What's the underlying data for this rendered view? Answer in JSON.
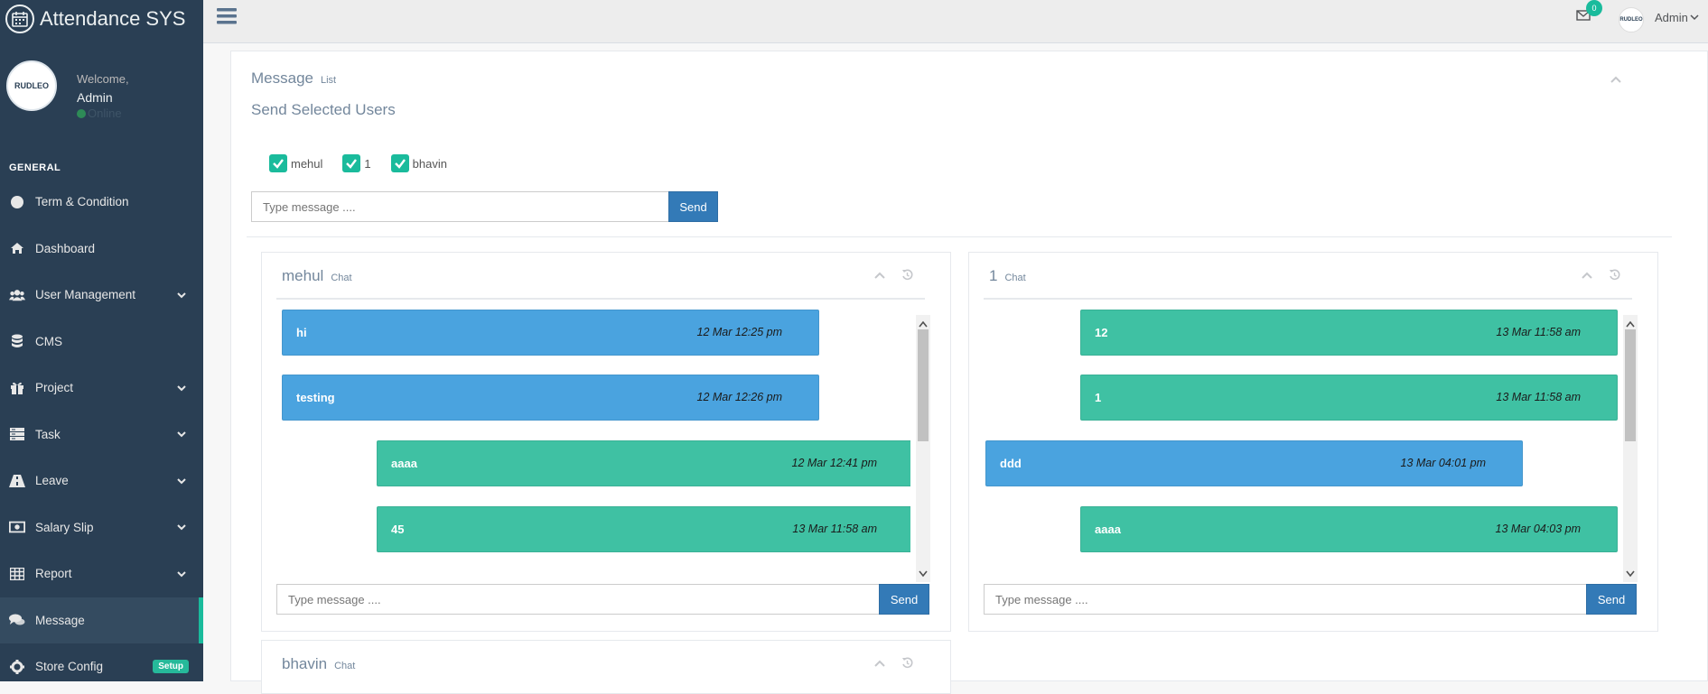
{
  "brand": {
    "title": "Attendance SYS",
    "logo_text": "RUDLEO"
  },
  "profile": {
    "welcome": "Welcome,",
    "name": "Admin",
    "status": "Online"
  },
  "sidebar": {
    "section": "GENERAL",
    "items": [
      {
        "label": "Term & Condition",
        "icon": "circle-icon"
      },
      {
        "label": "Dashboard",
        "icon": "home-icon"
      },
      {
        "label": "User Management",
        "icon": "users-icon"
      },
      {
        "label": "CMS",
        "icon": "database-icon"
      },
      {
        "label": "Project",
        "icon": "gift-icon"
      },
      {
        "label": "Task",
        "icon": "server-icon"
      },
      {
        "label": "Leave",
        "icon": "road-icon"
      },
      {
        "label": "Salary Slip",
        "icon": "money-icon"
      },
      {
        "label": "Report",
        "icon": "table-icon"
      },
      {
        "label": "Message",
        "icon": "comments-icon"
      },
      {
        "label": "Store Config",
        "icon": "gear-icon",
        "badge": "Setup"
      }
    ]
  },
  "topbar": {
    "mail_count": "0",
    "user": "Admin",
    "avatar_text": "RUDLEO"
  },
  "panel": {
    "title": "Message",
    "title_small": "List",
    "subheading": "Send Selected Users",
    "users": [
      "mehul",
      "1",
      "bhavin"
    ],
    "input_placeholder": "Type message ....",
    "send_label": "Send"
  },
  "chats": [
    {
      "title": "mehul",
      "small": "Chat",
      "messages": [
        {
          "text": "hi",
          "time": "12 Mar 12:25 pm",
          "color": "blue"
        },
        {
          "text": "testing",
          "time": "12 Mar 12:26 pm",
          "color": "blue"
        },
        {
          "text": "aaaa",
          "time": "12 Mar 12:41 pm",
          "color": "green"
        },
        {
          "text": "45",
          "time": "13 Mar 11:58 am",
          "color": "green"
        }
      ],
      "input_placeholder": "Type message ....",
      "send_label": "Send"
    },
    {
      "title": "1",
      "small": "Chat",
      "messages": [
        {
          "text": "12",
          "time": "13 Mar 11:58 am",
          "color": "green"
        },
        {
          "text": "1",
          "time": "13 Mar 11:58 am",
          "color": "green"
        },
        {
          "text": "ddd",
          "time": "13 Mar 04:01 pm",
          "color": "blue"
        },
        {
          "text": "aaaa",
          "time": "13 Mar 04:03 pm",
          "color": "green"
        }
      ],
      "input_placeholder": "Type message ....",
      "send_label": "Send"
    },
    {
      "title": "bhavin",
      "small": "Chat"
    }
  ],
  "colors": {
    "sidebar": "#2a3f54",
    "accent": "#1abb9c",
    "blue_msg": "#4aa3df",
    "green_msg": "#3fc1a3",
    "button": "#337ab7"
  }
}
